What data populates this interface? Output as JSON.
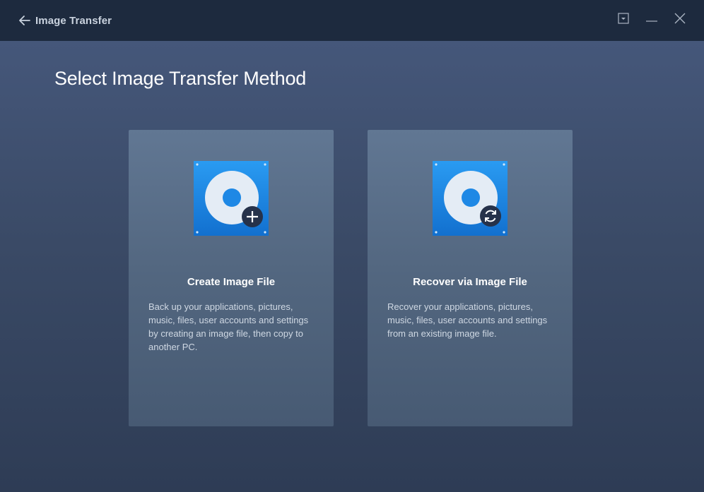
{
  "titlebar": {
    "title": "Image Transfer",
    "icons": {
      "back": "arrow-left-icon",
      "menu": "dropdown-menu-icon",
      "minimize": "minimize-icon",
      "close": "close-icon"
    }
  },
  "main": {
    "title": "Select Image Transfer Method",
    "cards": [
      {
        "title": "Create Image File",
        "description": "Back up your applications, pictures, music, files, user accounts and settings by creating an image file, then copy to another PC.",
        "icon": "disk-add-icon"
      },
      {
        "title": "Recover via Image File",
        "description": "Recover your applications, pictures, music, files, user accounts and settings from an existing image file.",
        "icon": "disk-restore-icon"
      }
    ]
  },
  "colors": {
    "titlebar_bg": "#1d2a3e",
    "content_bg": "#3a4a66",
    "card_bg": "#5b6f8a",
    "icon_blue": "#1e88e5"
  }
}
